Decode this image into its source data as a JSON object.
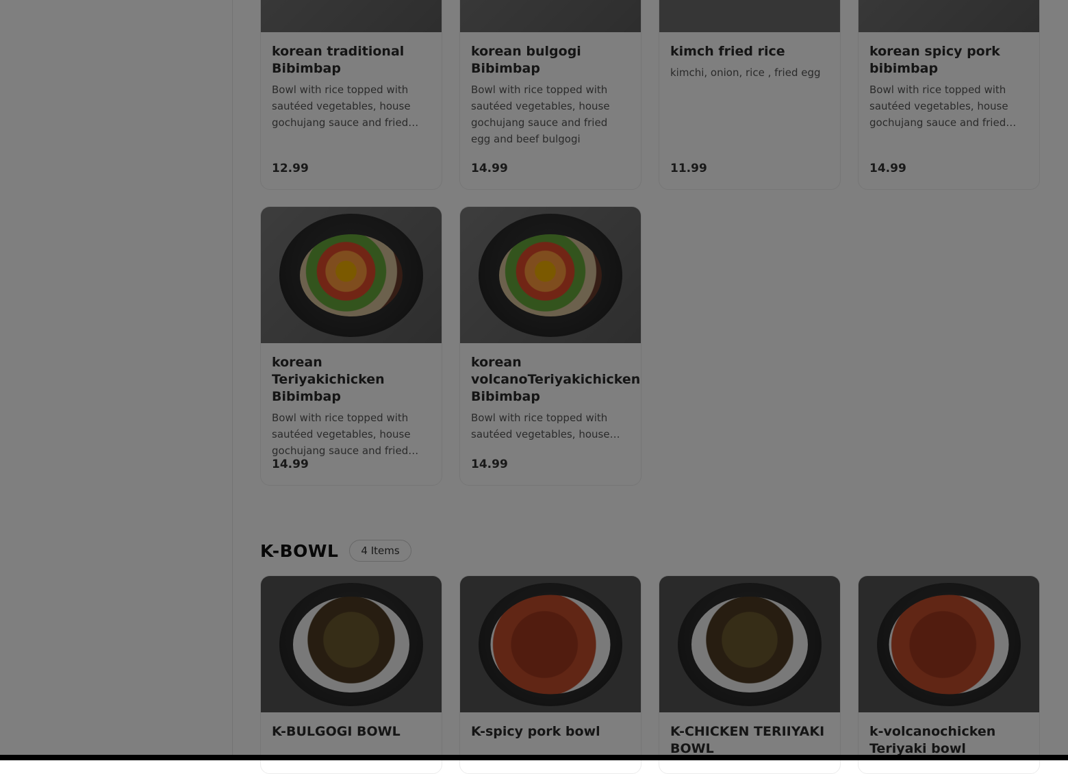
{
  "menu": {
    "top_row": [
      {
        "name": "korean traditional Bibimbap",
        "description": "Bowl with rice topped with sautéed vegetables, house gochujang sauce and fried egg",
        "price": "12.99"
      },
      {
        "name": "korean bulgogi Bibimbap",
        "description": "Bowl with rice topped with sautéed vegetables, house gochujang sauce and fried egg and beef bulgogi",
        "price": "14.99"
      },
      {
        "name": "kimch fried rice",
        "description": "kimchi, onion, rice , fried egg",
        "price": "11.99"
      },
      {
        "name": "korean spicy pork bibimbap",
        "description": "Bowl with rice topped with sautéed vegetables, house gochujang sauce and fried egg and spicy pork",
        "price": "14.99"
      }
    ],
    "second_row": [
      {
        "name": "korean Teriyakichicken Bibimbap",
        "description": "Bowl with rice topped with sautéed vegetables, house gochujang sauce and fried egg and teriyaki chicken",
        "price": "14.99"
      },
      {
        "name": "korean volcanoTeriyakichicken Bibimbap",
        "description": "Bowl with rice topped with sautéed vegetables, house gochujang sauce and fried egg",
        "price": "14.99"
      }
    ],
    "kbowl_section": {
      "title": "K-BOWL",
      "count": "4 Items",
      "items": [
        {
          "name": "K-BULGOGI BOWL"
        },
        {
          "name": "K-spicy pork bowl"
        },
        {
          "name": "K-CHICKEN TERIIYAKI BOWL"
        },
        {
          "name": "k-volcanochicken Teriyaki bowl"
        }
      ]
    }
  },
  "colors": {
    "overlay": "rgba(0,0,0,0.5)",
    "card_border": "#ececec"
  }
}
